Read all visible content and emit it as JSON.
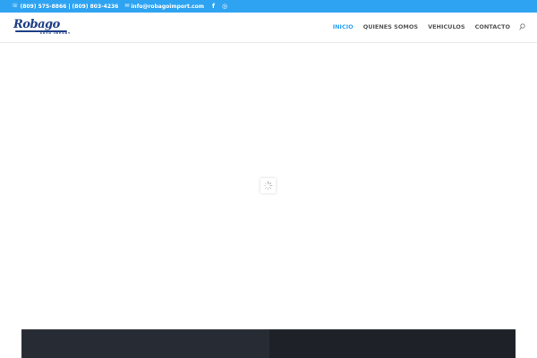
{
  "topbar": {
    "phone_icon": "phone-icon",
    "phone_1": "(809) 575-8866",
    "phone_separator": "|",
    "phone_2": "(809) 803-4236",
    "email_icon": "envelope-icon",
    "email": "info@robagoimport.com",
    "social": [
      {
        "icon": "facebook-icon",
        "glyph": "f"
      },
      {
        "icon": "instagram-icon",
        "glyph": "◎"
      }
    ]
  },
  "header": {
    "logo_text": "Robago",
    "logo_subtext": "AUTO IMPORT",
    "nav": [
      {
        "label": "INICIO",
        "active": true
      },
      {
        "label": "QUIENES SOMOS",
        "active": false
      },
      {
        "label": "VEHICULOS",
        "active": false
      },
      {
        "label": "CONTACTO",
        "active": false
      }
    ],
    "search_icon": "search-icon"
  },
  "colors": {
    "accent": "#2ea3f2",
    "logo": "#1d3f86",
    "nav_text": "#555555",
    "footer_left": "#272b33",
    "footer_right": "#1e2228"
  }
}
